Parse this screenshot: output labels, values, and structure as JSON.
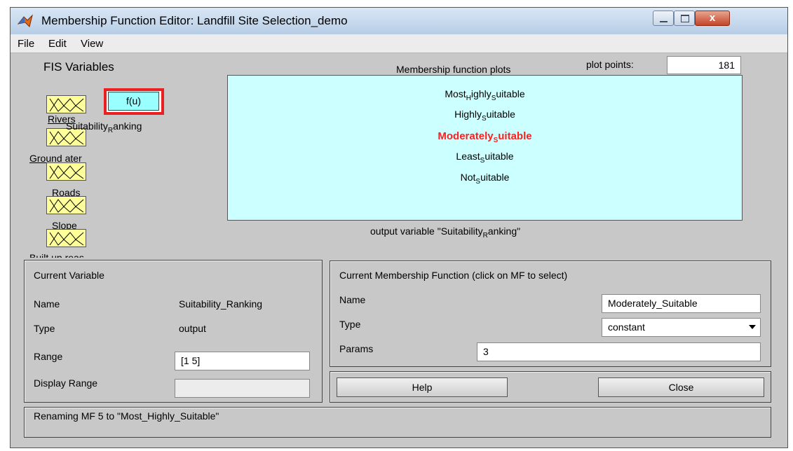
{
  "window": {
    "title": "Membership Function Editor: Landfill Site Selection_demo",
    "close_glyph": "x"
  },
  "menu": [
    "File",
    "Edit",
    "View"
  ],
  "fis": {
    "title": "FIS Variables",
    "inputs": [
      {
        "label": "Rivers"
      },
      {
        "label": "Ground  ater"
      },
      {
        "label": "Roads"
      },
      {
        "label": "Slope"
      },
      {
        "label": "Built up  reas"
      }
    ],
    "output": {
      "box_label": "f(u)",
      "label_pre": "Suitability",
      "label_sub": "R",
      "label_post": "anking"
    }
  },
  "plots": {
    "title": "Membership function plots",
    "plot_points_label": "plot points:",
    "plot_points_value": "181",
    "caption_pre": "output variable \"Suitability",
    "caption_sub": "R",
    "caption_post": "anking\"",
    "mfs": [
      {
        "pre": "Most",
        "sub": "H",
        "post": "ighly",
        "sub2": "S",
        "post2": "uitable",
        "selected": false
      },
      {
        "pre": "Highly",
        "sub": "S",
        "post": "uitable",
        "sub2": "",
        "post2": "",
        "selected": false
      },
      {
        "pre": "Moderately",
        "sub": "S",
        "post": "uitable",
        "sub2": "",
        "post2": "",
        "selected": true
      },
      {
        "pre": "Least",
        "sub": "S",
        "post": "uitable",
        "sub2": "",
        "post2": "",
        "selected": false
      },
      {
        "pre": "Not",
        "sub": "S",
        "post": "uitable",
        "sub2": "",
        "post2": "",
        "selected": false
      }
    ]
  },
  "current_variable": {
    "title": "Current Variable",
    "name_label": "Name",
    "name_value": "Suitability_Ranking",
    "type_label": "Type",
    "type_value": "output",
    "range_label": "Range",
    "range_value": "[1 5]",
    "display_range_label": "Display Range",
    "display_range_value": ""
  },
  "current_mf": {
    "title": "Current Membership Function (click on MF to select)",
    "name_label": "Name",
    "name_value": "Moderately_Suitable",
    "type_label": "Type",
    "type_value": "constant",
    "params_label": "Params",
    "params_value": "3"
  },
  "buttons": {
    "help": "Help",
    "close": "Close"
  },
  "status": "Renaming MF 5 to \"Most_Highly_Suitable\"",
  "colors": {
    "input_box": "#ffff99",
    "output_box": "#99ffff",
    "plot_bg": "#ccffff",
    "selected_mf": "#ff2020",
    "highlight": "#e82020"
  }
}
